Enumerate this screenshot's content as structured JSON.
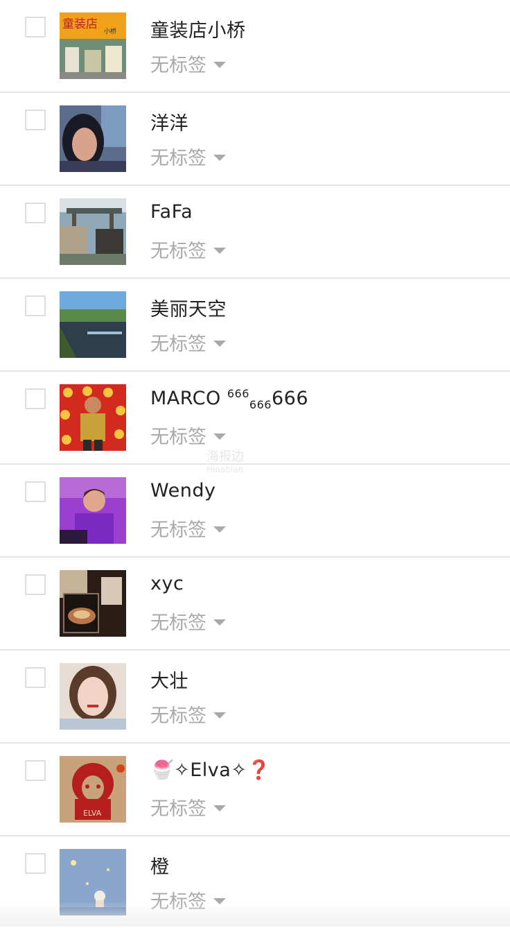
{
  "contacts": [
    {
      "name": "童装店小桥",
      "tag": "无标签",
      "avatar": "shop-storefront"
    },
    {
      "name": "洋洋",
      "tag": "无标签",
      "avatar": "woman-portrait"
    },
    {
      "name": "FaFa",
      "tag": "无标签",
      "avatar": "garden-pavilion"
    },
    {
      "name": "美丽天空",
      "tag": "无标签",
      "avatar": "river-landscape"
    },
    {
      "name_parts": [
        "MARCO ",
        "666",
        "666",
        "666"
      ],
      "tag": "无标签",
      "avatar": "man-red-background"
    },
    {
      "name": "Wendy",
      "tag": "无标签",
      "avatar": "purple-portrait"
    },
    {
      "name": "xyc",
      "tag": "无标签",
      "avatar": "food-hand"
    },
    {
      "name": "大壮",
      "tag": "无标签",
      "avatar": "girl-portrait"
    },
    {
      "name": "🍧✧Elva✧❓",
      "tag": "无标签",
      "avatar": "red-paper-cut"
    },
    {
      "name": "橙",
      "tag": "无标签",
      "avatar": "blue-illustration"
    }
  ],
  "avatar_labels": {
    "shop_sign": "童装店",
    "shop_sub": "小桥",
    "elva_text": "ELVA"
  },
  "watermark": {
    "cn": "海报边",
    "en": "Hinabian"
  }
}
